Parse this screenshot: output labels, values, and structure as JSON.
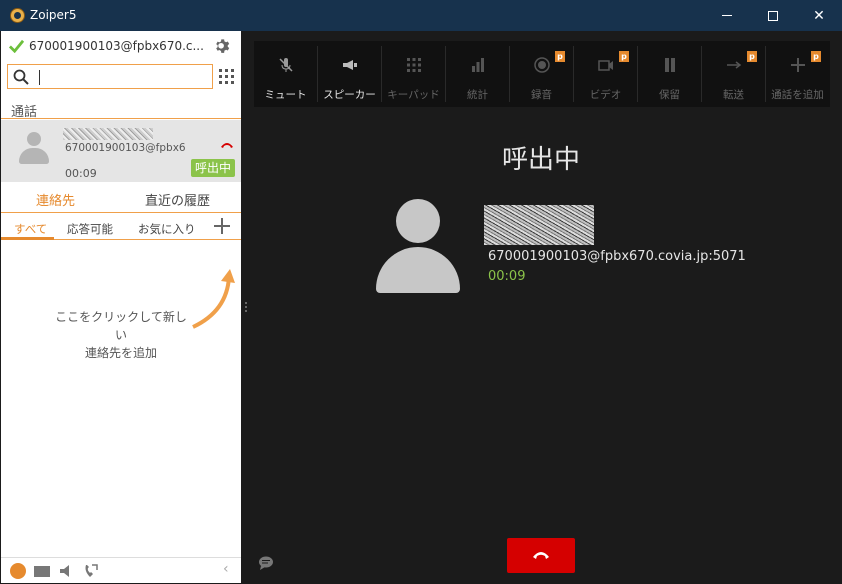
{
  "window": {
    "title": "Zoiper5"
  },
  "account": {
    "label": "670001900103@fpbx670.c..."
  },
  "search": {
    "value": "",
    "placeholder": ""
  },
  "calls_section": {
    "label": "通話"
  },
  "active_call_item": {
    "address": "670001900103@fpbx6...",
    "time": "00:09",
    "status": "呼出中"
  },
  "tabs": {
    "contacts": "連絡先",
    "recent": "直近の履歴"
  },
  "filters": {
    "all": "すべて",
    "available": "応答可能",
    "favorites": "お気に入り"
  },
  "hint": {
    "line1": "ここをクリックして新しい",
    "line2": "連絡先を追加"
  },
  "toolbar": [
    {
      "label": "ミュート",
      "icon": "mic-muted-icon",
      "active": true,
      "premium": false
    },
    {
      "label": "スピーカー",
      "icon": "speaker-icon",
      "active": true,
      "premium": false
    },
    {
      "label": "キーパッド",
      "icon": "keypad-icon",
      "active": false,
      "premium": false
    },
    {
      "label": "統計",
      "icon": "stats-icon",
      "active": false,
      "premium": false
    },
    {
      "label": "録音",
      "icon": "record-icon",
      "active": false,
      "premium": true
    },
    {
      "label": "ビデオ",
      "icon": "video-icon",
      "active": false,
      "premium": true
    },
    {
      "label": "保留",
      "icon": "hold-icon",
      "active": false,
      "premium": false
    },
    {
      "label": "転送",
      "icon": "transfer-icon",
      "active": false,
      "premium": true
    },
    {
      "label": "通話を追加",
      "icon": "add-call-icon",
      "active": false,
      "premium": true
    }
  ],
  "premium_badge": "p",
  "call_view": {
    "status": "呼出中",
    "address": "670001900103@fpbx670.covia.jp:5071",
    "timer": "00:09"
  },
  "colors": {
    "titlebar": "#17324d",
    "accent": "#e68a2e",
    "timer_green": "#8bc34a",
    "hangup_red": "#d50000"
  }
}
